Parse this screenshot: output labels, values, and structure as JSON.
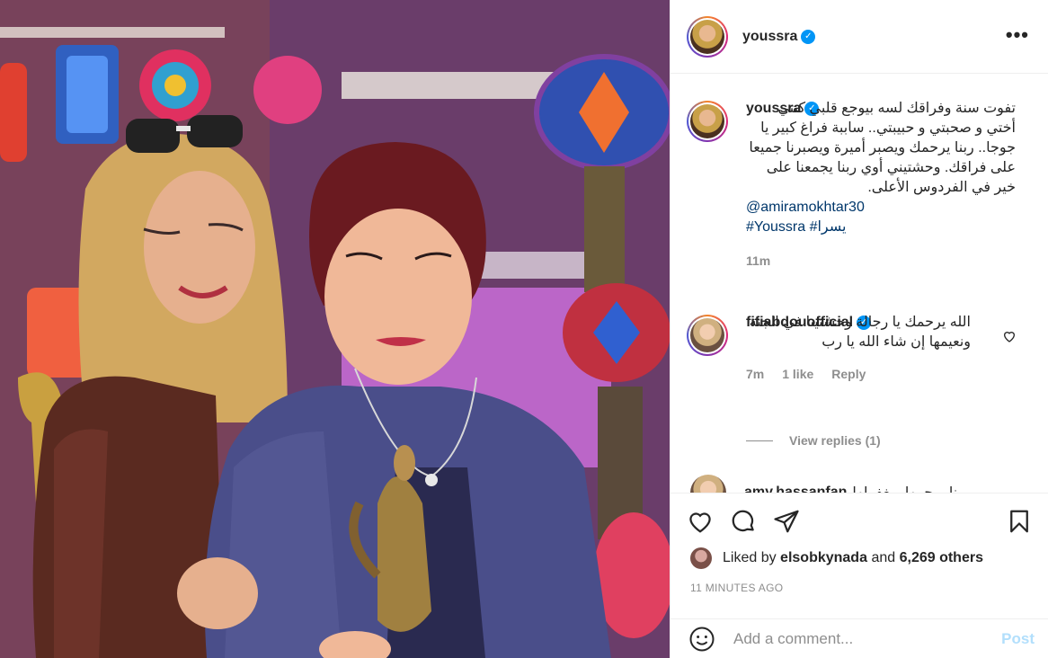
{
  "post": {
    "username": "youssra",
    "more_label": "•••",
    "verified_mark": "✓"
  },
  "caption": {
    "username": "youssra",
    "text": "تفوت سنة وفراقك لسه بيوجع قلبي كنتي أختي و صحبتي و حبيبتي.. ساببة فراغ كبير يا جوجا.. ربنا يرحمك ويصبر أميرة ويصبرنا جميعا على فراقك. وحشتيني أوي ربنا يجمعنا على خير في الفردوس الأعلى.",
    "mention": "@amiramokhtar30",
    "hashtags": "#Youssra #يسرا",
    "time": "11m"
  },
  "comments": [
    {
      "username": "fifiabdouofficial",
      "text": "الله يرحمك يا رجالة وحشتينا في الجنة ونعيمها إن شاء الله يا رب",
      "time": "7m",
      "likes": "1 like",
      "reply_label": "Reply",
      "view_replies": "View replies (1)"
    },
    {
      "username": "amy.hassanfan",
      "text": "ربنا يرحمها ويغفرلها"
    }
  ],
  "likes": {
    "prefix": "Liked by",
    "user": "elsobkynada",
    "middle": "and",
    "others": "6,269 others"
  },
  "timestamp": "11 MINUTES AGO",
  "add_comment": {
    "placeholder": "Add a comment...",
    "post_label": "Post"
  },
  "icons": [
    "heart-icon",
    "comment-icon",
    "share-icon",
    "bookmark-icon",
    "emoji-icon",
    "more-icon",
    "verified-icon"
  ]
}
